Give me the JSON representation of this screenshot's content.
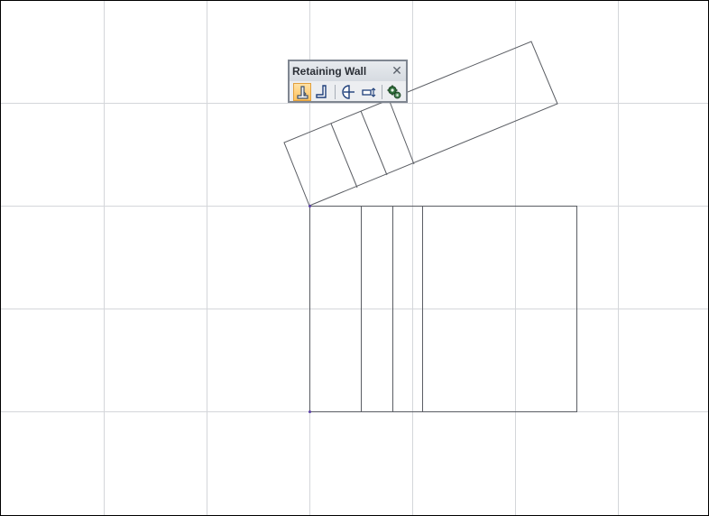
{
  "toolbar": {
    "title": "Retaining Wall",
    "close_glyph": "✕",
    "buttons": [
      {
        "icon": "retaining-wall-icon",
        "active": true
      },
      {
        "icon": "l-shaped-wall-icon",
        "active": false
      },
      {
        "icon": "split-wall-icon",
        "active": false
      },
      {
        "icon": "move-wall-icon",
        "active": false
      },
      {
        "icon": "wall-settings-gear-icon",
        "active": false
      }
    ]
  },
  "colors": {
    "grid": "#d4d6da",
    "geometry": "#5a5d63",
    "snap_point": "#5b3fa6",
    "toolbar_accent": "#ffc35e"
  }
}
